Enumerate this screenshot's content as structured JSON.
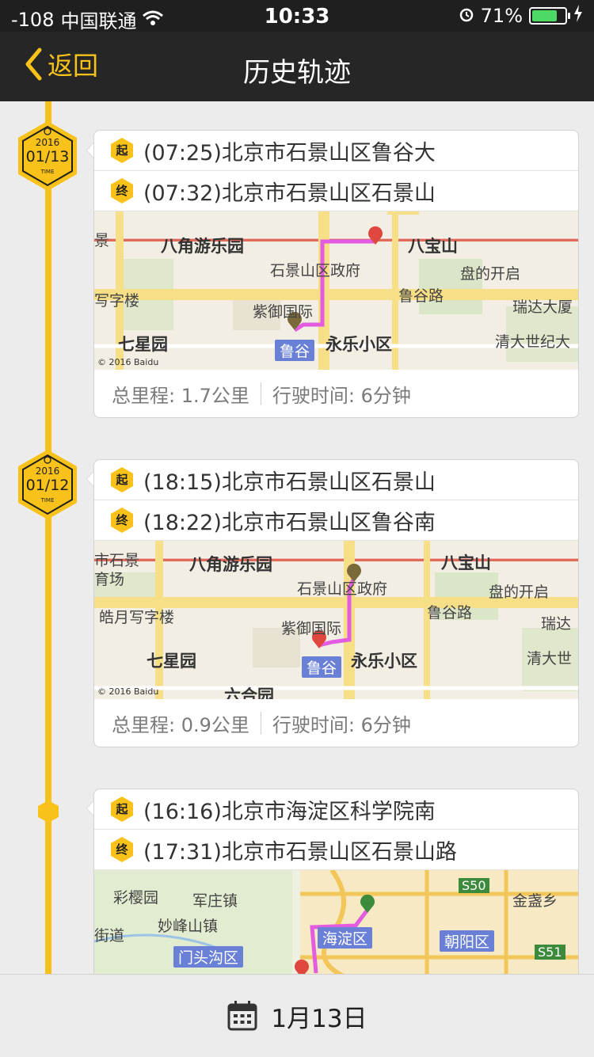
{
  "status_bar": {
    "signal": "-108",
    "carrier": "中国联通",
    "time": "10:33",
    "battery": "71%"
  },
  "nav": {
    "back_label": "返回",
    "title": "历史轨迹"
  },
  "trips": [
    {
      "badge": {
        "year": "2016",
        "date": "01/13",
        "caption": "TIME"
      },
      "start_tag": "起",
      "end_tag": "终",
      "start": "(07:25)北京市石景山区鲁谷大",
      "end": "(07:32)北京市石景山区石景山",
      "map_labels": [
        "八角游乐园",
        "八宝山",
        "石景山区政府",
        "盘的开启",
        "鲁谷路",
        "写字楼",
        "紫御国际",
        "瑞达大厦",
        "七星园",
        "鲁谷",
        "永乐小区",
        "清大世纪大",
        "景"
      ],
      "map_copyright": "© 2016 Baidu",
      "distance": "总里程: 1.7公里",
      "duration": "行驶时间: 6分钟"
    },
    {
      "badge": {
        "year": "2016",
        "date": "01/12",
        "caption": "TIME"
      },
      "start_tag": "起",
      "end_tag": "终",
      "start": "(18:15)北京市石景山区石景山",
      "end": "(18:22)北京市石景山区鲁谷南",
      "map_labels": [
        "市石景",
        "育场",
        "八角游乐园",
        "八宝山",
        "石景山区政府",
        "盘的开启",
        "鲁谷路",
        "皓月写字楼",
        "紫御国际",
        "瑞达",
        "七星园",
        "鲁谷",
        "永乐小区",
        "清大世",
        "六合园"
      ],
      "map_copyright": "© 2016 Baidu",
      "distance": "总里程: 0.9公里",
      "duration": "行驶时间: 6分钟"
    },
    {
      "start_tag": "起",
      "end_tag": "终",
      "start": "(16:16)北京市海淀区科学院南",
      "end": "(17:31)北京市石景山区石景山路",
      "map_labels": [
        "彩樱园",
        "军庄镇",
        "S50",
        "金盏乡",
        "街道",
        "妙峰山镇",
        "海淀区",
        "朝阳区",
        "门头沟区",
        "S51"
      ]
    }
  ],
  "footer": {
    "date": "1月13日"
  }
}
